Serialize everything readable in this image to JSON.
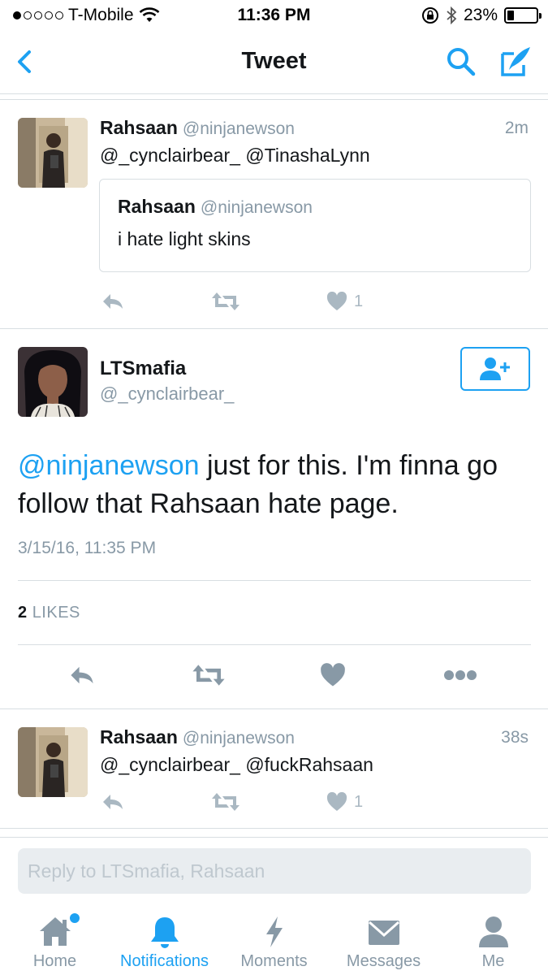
{
  "status_bar": {
    "carrier": "T-Mobile",
    "time": "11:36 PM",
    "battery": "23%",
    "battery_level": 0.23,
    "signal_bars_filled": 1
  },
  "nav": {
    "title": "Tweet",
    "icons": [
      "back-chevron-icon",
      "search-icon",
      "compose-icon"
    ]
  },
  "reply_above": {
    "name": "Rahsaan",
    "handle": "@ninjanewson",
    "age": "2m",
    "text": "@_cynclairbear_ @TinashaLynn",
    "quoted": {
      "name": "Rahsaan",
      "handle": "@ninjanewson",
      "text": "i hate light skins"
    },
    "like_count": "1"
  },
  "main_tweet": {
    "name": "LTSmafia",
    "handle": "@_cynclairbear_",
    "mention": "@ninjanewson",
    "text_line1": " just for this. I'm finna go",
    "text_line2": "follow that Rahsaan hate page.",
    "timestamp": "3/15/16, 11:35 PM",
    "likes_count": "2",
    "likes_label": "LIKES"
  },
  "reply_below": {
    "name": "Rahsaan",
    "handle": "@ninjanewson",
    "age": "38s",
    "text": "@_cynclairbear_ @fuckRahsaan",
    "like_count": "1"
  },
  "reply_input": {
    "placeholder": "Reply to LTSmafia, Rahsaan"
  },
  "tabs": [
    {
      "label": "Home",
      "icon": "home-icon"
    },
    {
      "label": "Notifications",
      "icon": "bell-icon",
      "active": true
    },
    {
      "label": "Moments",
      "icon": "lightning-icon"
    },
    {
      "label": "Messages",
      "icon": "envelope-icon"
    },
    {
      "label": "Me",
      "icon": "person-icon"
    }
  ],
  "colors": {
    "accent": "#1da1f2",
    "muted": "#8899a6",
    "action_gray": "#aab8c2",
    "divider": "#d8dee2"
  }
}
